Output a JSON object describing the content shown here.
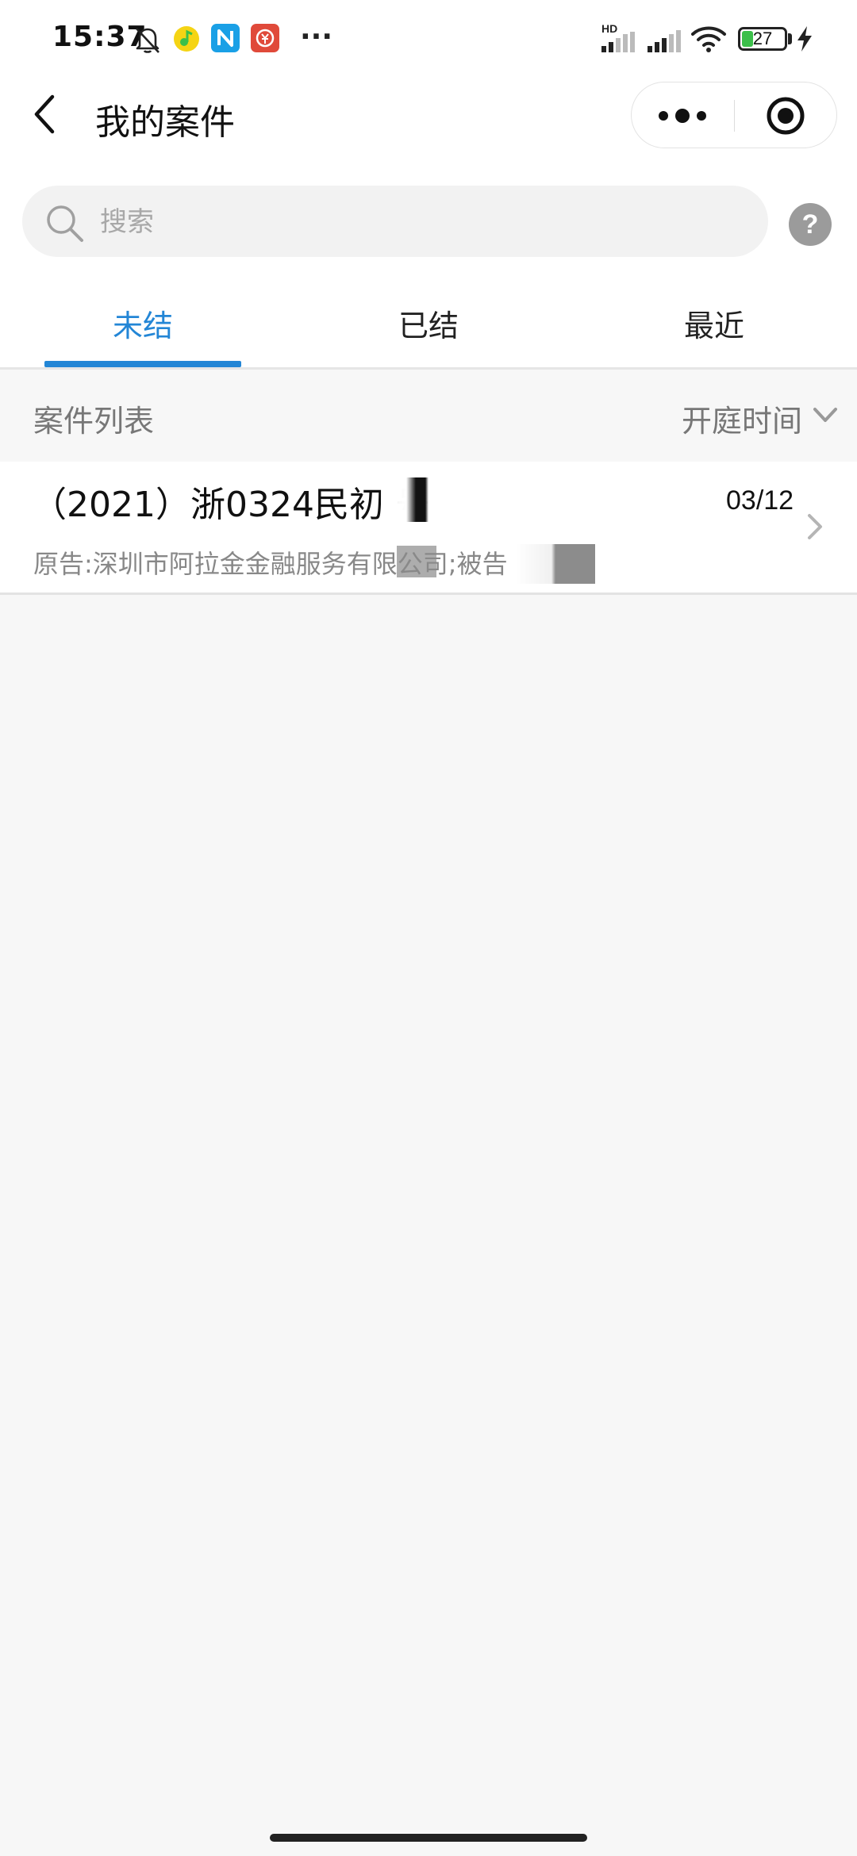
{
  "status_bar": {
    "time": "15:37",
    "battery_level": "27",
    "network_label": "HD",
    "more_label": "···",
    "icons": [
      "bell-muted-icon",
      "music-app-icon",
      "n-app-icon",
      "payment-app-icon",
      "signal-icon",
      "signal-icon",
      "wifi-icon",
      "battery-icon",
      "charging-icon"
    ]
  },
  "header": {
    "title": "我的案件"
  },
  "search": {
    "placeholder": "搜索",
    "help_label": "?"
  },
  "tabs": [
    {
      "label": "未结",
      "active": true
    },
    {
      "label": "已结",
      "active": false
    },
    {
      "label": "最近",
      "active": false
    }
  ],
  "list": {
    "title": "案件列表",
    "sort_label": "开庭时间"
  },
  "cases": [
    {
      "number": "（2021）浙0324民初      号",
      "date": "03/12",
      "parties": "原告:深圳市阿拉金金融服务有限公司;被告"
    }
  ],
  "colors": {
    "accent": "#2386d6",
    "background": "#f7f7f7",
    "secondary_text": "#888888"
  }
}
